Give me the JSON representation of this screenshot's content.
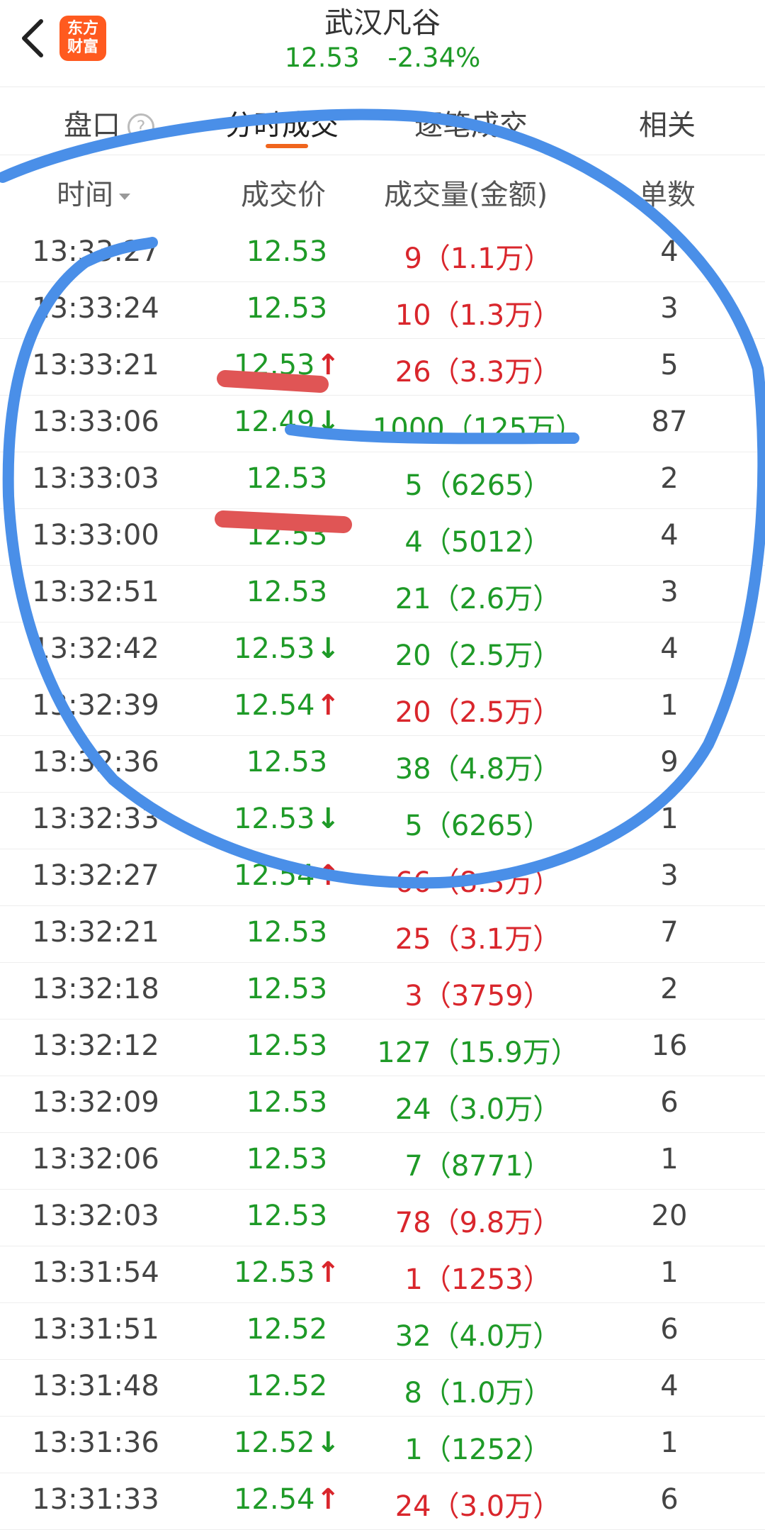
{
  "header": {
    "title": "武汉凡谷",
    "price": "12.53",
    "change_pct": "-2.34%",
    "app_logo_line1": "东方",
    "app_logo_line2": "财富"
  },
  "tabs": [
    {
      "label": "盘口"
    },
    {
      "label": "分时成交",
      "active": true
    },
    {
      "label": "逐笔成交"
    },
    {
      "label": "相关"
    }
  ],
  "columns": {
    "time": "时间",
    "price": "成交价",
    "volume": "成交量(金额)",
    "count": "单数"
  },
  "trades": [
    {
      "time": "13:33:27",
      "price": "12.53",
      "dir": "",
      "volume": "9（1.1万）",
      "vol_color": "red",
      "count": "4"
    },
    {
      "time": "13:33:24",
      "price": "12.53",
      "dir": "",
      "volume": "10（1.3万）",
      "vol_color": "red",
      "count": "3"
    },
    {
      "time": "13:33:21",
      "price": "12.53",
      "dir": "up",
      "volume": "26（3.3万）",
      "vol_color": "red",
      "count": "5"
    },
    {
      "time": "13:33:06",
      "price": "12.49",
      "dir": "down",
      "volume": "1000（125万）",
      "vol_color": "green",
      "count": "87"
    },
    {
      "time": "13:33:03",
      "price": "12.53",
      "dir": "",
      "volume": "5（6265）",
      "vol_color": "green",
      "count": "2"
    },
    {
      "time": "13:33:00",
      "price": "12.53",
      "dir": "",
      "volume": "4（5012）",
      "vol_color": "green",
      "count": "4"
    },
    {
      "time": "13:32:51",
      "price": "12.53",
      "dir": "",
      "volume": "21（2.6万）",
      "vol_color": "green",
      "count": "3"
    },
    {
      "time": "13:32:42",
      "price": "12.53",
      "dir": "down",
      "volume": "20（2.5万）",
      "vol_color": "green",
      "count": "4"
    },
    {
      "time": "13:32:39",
      "price": "12.54",
      "dir": "up",
      "volume": "20（2.5万）",
      "vol_color": "red",
      "count": "1"
    },
    {
      "time": "13:32:36",
      "price": "12.53",
      "dir": "",
      "volume": "38（4.8万）",
      "vol_color": "green",
      "count": "9"
    },
    {
      "time": "13:32:33",
      "price": "12.53",
      "dir": "down",
      "volume": "5（6265）",
      "vol_color": "green",
      "count": "1"
    },
    {
      "time": "13:32:27",
      "price": "12.54",
      "dir": "up",
      "volume": "66（8.3万）",
      "vol_color": "red",
      "count": "3"
    },
    {
      "time": "13:32:21",
      "price": "12.53",
      "dir": "",
      "volume": "25（3.1万）",
      "vol_color": "red",
      "count": "7"
    },
    {
      "time": "13:32:18",
      "price": "12.53",
      "dir": "",
      "volume": "3（3759）",
      "vol_color": "red",
      "count": "2"
    },
    {
      "time": "13:32:12",
      "price": "12.53",
      "dir": "",
      "volume": "127（15.9万）",
      "vol_color": "green",
      "count": "16"
    },
    {
      "time": "13:32:09",
      "price": "12.53",
      "dir": "",
      "volume": "24（3.0万）",
      "vol_color": "green",
      "count": "6"
    },
    {
      "time": "13:32:06",
      "price": "12.53",
      "dir": "",
      "volume": "7（8771）",
      "vol_color": "green",
      "count": "1"
    },
    {
      "time": "13:32:03",
      "price": "12.53",
      "dir": "",
      "volume": "78（9.8万）",
      "vol_color": "red",
      "count": "20"
    },
    {
      "time": "13:31:54",
      "price": "12.53",
      "dir": "up",
      "volume": "1（1253）",
      "vol_color": "red",
      "count": "1"
    },
    {
      "time": "13:31:51",
      "price": "12.52",
      "dir": "",
      "volume": "32（4.0万）",
      "vol_color": "green",
      "count": "6"
    },
    {
      "time": "13:31:48",
      "price": "12.52",
      "dir": "",
      "volume": "8（1.0万）",
      "vol_color": "green",
      "count": "4"
    },
    {
      "time": "13:31:36",
      "price": "12.52",
      "dir": "down",
      "volume": "1（1252）",
      "vol_color": "green",
      "count": "1"
    },
    {
      "time": "13:31:33",
      "price": "12.54",
      "dir": "up",
      "volume": "24（3.0万）",
      "vol_color": "red",
      "count": "6"
    }
  ],
  "colors": {
    "up": "#d9262c",
    "down": "#1e9a27",
    "accent": "#f0651d",
    "annotation_blue": "#4a8fe8",
    "annotation_red": "#e05555"
  }
}
